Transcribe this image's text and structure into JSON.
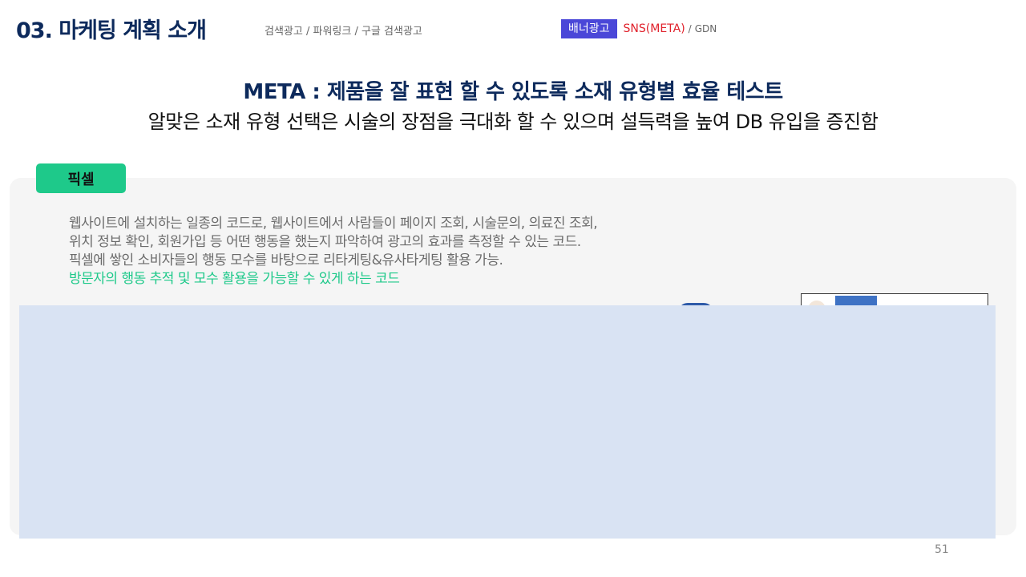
{
  "header": {
    "section_title": "03. 마케팅 계획 소개",
    "breadcrumb": "검색광고 / 파워링크 / 구글 검색광고",
    "tabs": {
      "active": "배너광고",
      "current": "SNS(META)",
      "separator": "/",
      "other": "GDN"
    }
  },
  "headline": "META : 제품을 잘 표현 할 수 있도록 소재 유형별 효율 테스트",
  "subheadline": "알맞은 소재 유형 선택은 시술의 장점을 극대화 할 수 있으며 설득력을 높여 DB 유입을 증진함",
  "pixel_section": {
    "badge": "픽셀",
    "lines": [
      "웹사이트에 설치하는 일종의 코드로, 웹사이트에서 사람들이 페이지 조회, 시술문의, 의료진 조회,",
      "위치 정보 확인, 회원가입 등 어떤 행동을 했는지 파악하여 광고의 효과를 측정할 수 있는 코드.",
      "픽셀에 쌓인 소비자들의 행동 모수를 바탕으로 리타게팅&유사타게팅 활용 가능."
    ],
    "highlight": "방문자의 행동 추적 및 모수 활용을 가능할 수 있게 하는 코드"
  },
  "colors": {
    "navy": "#0d2a5c",
    "accent_purple": "#4a47d8",
    "accent_red": "#e0212b",
    "accent_green": "#1ec98a",
    "overlay_blue": "#d9e3f3"
  },
  "page_number": "51"
}
